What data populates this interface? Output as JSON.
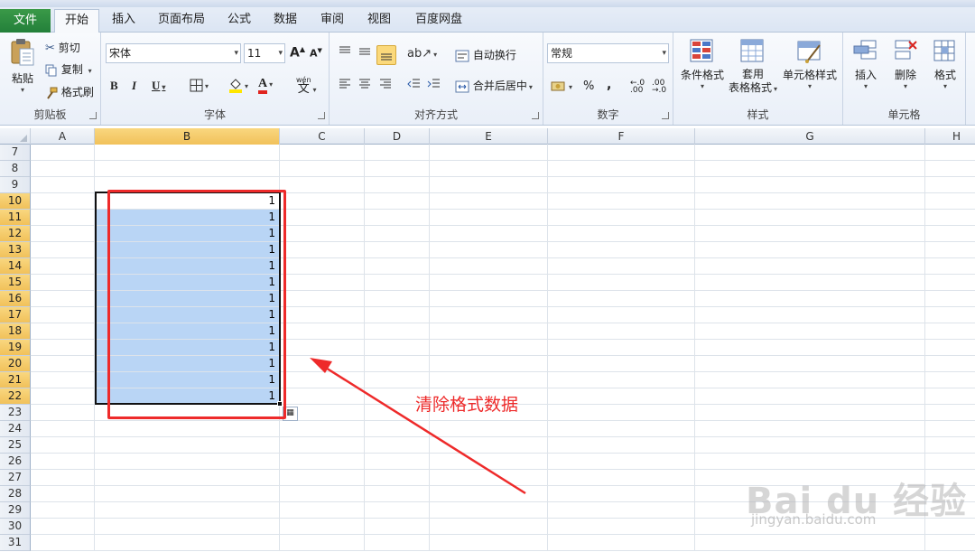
{
  "tabs": {
    "file": "文件",
    "items": [
      "开始",
      "插入",
      "页面布局",
      "公式",
      "数据",
      "审阅",
      "视图",
      "百度网盘"
    ],
    "active": "开始"
  },
  "clipboard": {
    "paste": "粘贴",
    "cut": "剪切",
    "copy": "复制",
    "format_painter": "格式刷",
    "label": "剪贴板"
  },
  "font": {
    "name": "宋体",
    "size": "11",
    "bold": "B",
    "italic": "I",
    "underline": "U",
    "label": "字体",
    "wen": "wén",
    "wen_char": "文"
  },
  "alignment": {
    "wrap_text": "自动换行",
    "merge_center": "合并后居中",
    "label": "对齐方式"
  },
  "number": {
    "format": "常规",
    "percent": "%",
    "comma": ",",
    "label": "数字"
  },
  "styles": {
    "conditional": "条件格式",
    "table_format_1": "套用",
    "table_format_2": "表格格式",
    "cell_styles": "单元格样式",
    "label": "样式"
  },
  "cells": {
    "insert": "插入",
    "delete": "删除",
    "format": "格式",
    "label": "单元格"
  },
  "columns": [
    "A",
    "B",
    "C",
    "D",
    "E",
    "F",
    "G",
    "H"
  ],
  "selected_column": "B",
  "rows": [
    {
      "n": "7",
      "b": ""
    },
    {
      "n": "8",
      "b": ""
    },
    {
      "n": "9",
      "b": ""
    },
    {
      "n": "10",
      "b": "1"
    },
    {
      "n": "11",
      "b": "1"
    },
    {
      "n": "12",
      "b": "1"
    },
    {
      "n": "13",
      "b": "1"
    },
    {
      "n": "14",
      "b": "1"
    },
    {
      "n": "15",
      "b": "1"
    },
    {
      "n": "16",
      "b": "1"
    },
    {
      "n": "17",
      "b": "1"
    },
    {
      "n": "18",
      "b": "1"
    },
    {
      "n": "19",
      "b": "1"
    },
    {
      "n": "20",
      "b": "1"
    },
    {
      "n": "21",
      "b": "1"
    },
    {
      "n": "22",
      "b": "1"
    },
    {
      "n": "23",
      "b": ""
    },
    {
      "n": "24",
      "b": ""
    },
    {
      "n": "25",
      "b": ""
    },
    {
      "n": "26",
      "b": ""
    },
    {
      "n": "27",
      "b": ""
    },
    {
      "n": "28",
      "b": ""
    },
    {
      "n": "29",
      "b": ""
    },
    {
      "n": "30",
      "b": ""
    },
    {
      "n": "31",
      "b": ""
    }
  ],
  "selected_rows": [
    "10",
    "11",
    "12",
    "13",
    "14",
    "15",
    "16",
    "17",
    "18",
    "19",
    "20",
    "21",
    "22"
  ],
  "annotation": {
    "text": "清除格式数据",
    "color": "#ee2a2a"
  },
  "watermark": {
    "main": "Bai du 经验",
    "sub": "jingyan.baidu.com"
  },
  "colors": {
    "file_tab": "#2a8a3e",
    "selection_fill": "#b9d5f5",
    "header_selected": "#f5c96a"
  }
}
